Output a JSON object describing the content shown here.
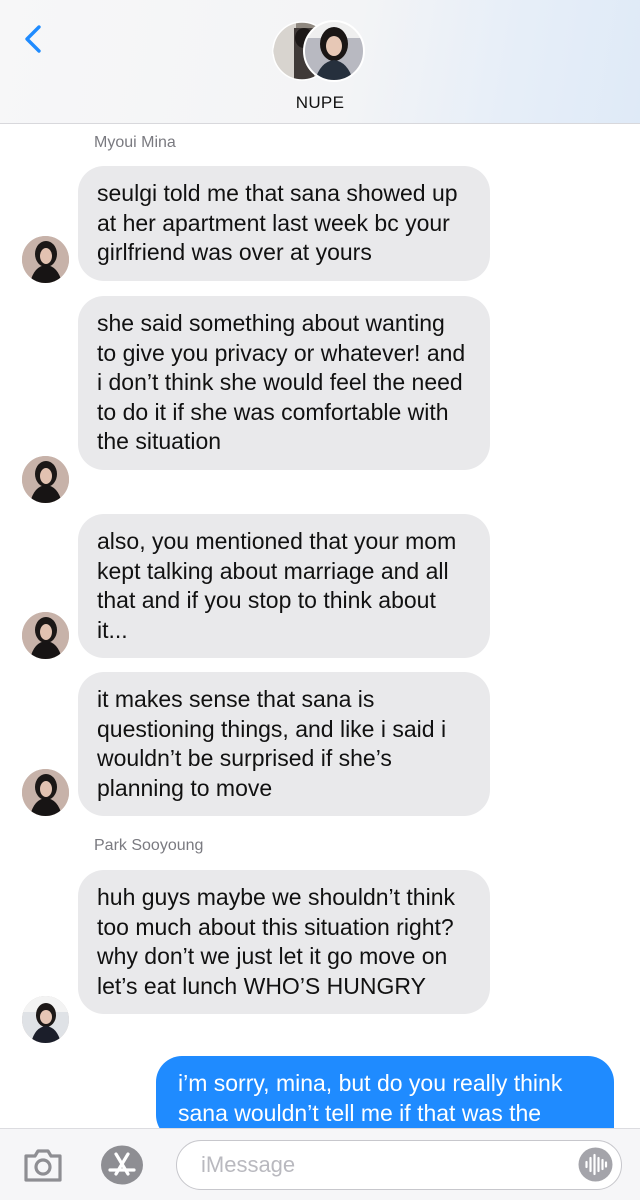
{
  "header": {
    "group_name": "NUPE"
  },
  "colors": {
    "accent": "#1f8bff",
    "incoming_bubble": "#e9e9eb",
    "sender_label": "#7a7a80"
  },
  "messages": [
    {
      "sender_label": "Myoui Mina"
    },
    {
      "text": "seulgi told me that sana showed up at her apartment last week bc your girlfriend was over at yours"
    },
    {
      "text": "she said something about wanting to give you privacy or whatever! and i don’t think she would feel the need to do it if she was comfortable with the situation"
    },
    {
      "text": "also, you mentioned that your mom kept talking about marriage and all that and if you stop to think about it..."
    },
    {
      "text": "it makes sense that sana is questioning things, and like i said i wouldn’t be surprised if she’s planning to move"
    },
    {
      "sender_label": "Park Sooyoung"
    },
    {
      "text": "huh guys maybe we shouldn’t think too much about this situation right? why don’t we just let it go move on let’s eat lunch WHO’S HUNGRY"
    },
    {
      "text": "i’m sorry, mina, but do you really think sana wouldn’t tell me if that was the"
    }
  ],
  "input_bar": {
    "placeholder": "iMessage",
    "icons": [
      "camera-icon",
      "app-store-icon",
      "audio-waveform-icon"
    ]
  },
  "icons": {
    "back": "chevron-left-icon"
  }
}
